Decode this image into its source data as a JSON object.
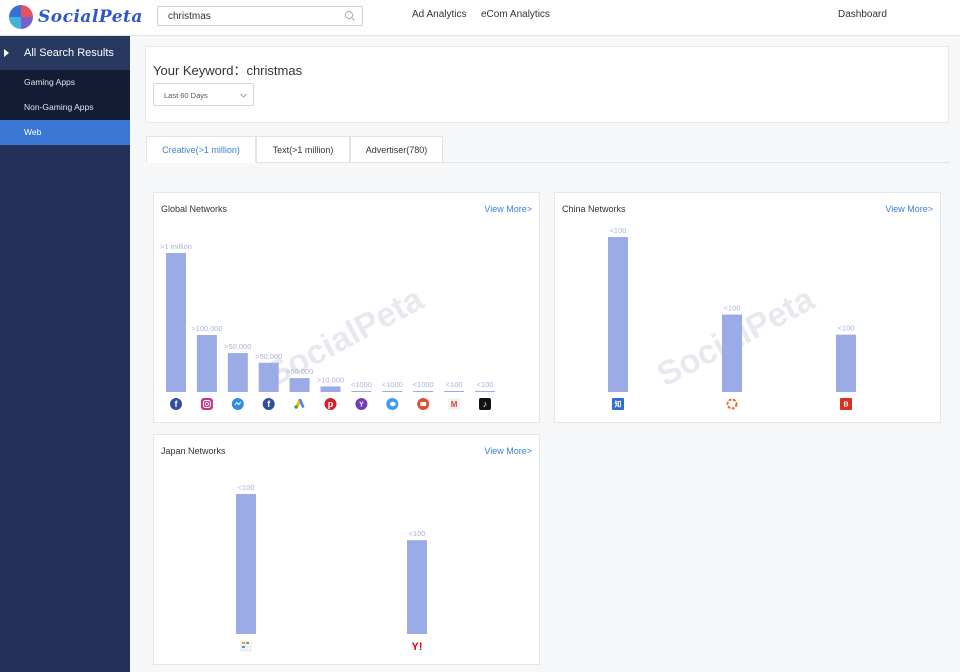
{
  "brand": {
    "name": "SocialPeta"
  },
  "header": {
    "search_value": "christmas",
    "nav": {
      "ad_analytics": "Ad Analytics",
      "ecom_analytics": "eCom Analytics",
      "dashboard": "Dashboard"
    }
  },
  "sidebar": {
    "section_label": "All Search Results",
    "items": [
      {
        "label": "Gaming Apps",
        "active": false
      },
      {
        "label": "Non-Gaming Apps",
        "active": false
      },
      {
        "label": "Web",
        "active": true
      }
    ]
  },
  "keyword": {
    "title": "Your Keyword：christmas",
    "date_range": "Last 60 Days"
  },
  "tabs": [
    {
      "label": "Creative(>1 million)",
      "active": true
    },
    {
      "label": "Text(>1 million)",
      "active": false
    },
    {
      "label": "Advertiser(780)",
      "active": false
    }
  ],
  "colors": {
    "bar": "#9aabe5",
    "bar_label": "#a7b3dc",
    "accent": "#3b84d8",
    "sidebar": "#24315a"
  },
  "chart_data": [
    {
      "type": "bar",
      "title": "Global Networks",
      "action_label": "View More>",
      "value_labels": [
        ">1 million",
        ">100,000",
        ">50,000",
        ">50,000",
        ">50,000",
        ">10,000",
        "<1000",
        "<1000",
        "<1000",
        "<100",
        "<100"
      ],
      "relative_values": [
        1.0,
        0.41,
        0.28,
        0.21,
        0.1,
        0.04,
        0.0,
        0.0,
        0.0,
        0.0,
        0.0
      ],
      "category_icons": [
        "facebook",
        "instagram",
        "messenger",
        "facebook",
        "google-ads",
        "pinterest",
        "yahoo",
        "twitter",
        "youtube",
        "gmail",
        "tiktok"
      ]
    },
    {
      "type": "bar",
      "title": "China Networks",
      "action_label": "View More>",
      "value_labels": [
        "<100",
        "<100",
        "<100"
      ],
      "relative_values": [
        1.0,
        0.5,
        0.37
      ],
      "category_icons": [
        "zhihu",
        "360-search",
        "baidu"
      ]
    },
    {
      "type": "bar",
      "title": "Japan Networks",
      "action_label": "View More>",
      "value_labels": [
        "<100",
        "<100"
      ],
      "relative_values": [
        1.0,
        0.67
      ],
      "category_icons": [
        "calendar-app",
        "yahoo-japan"
      ]
    }
  ]
}
